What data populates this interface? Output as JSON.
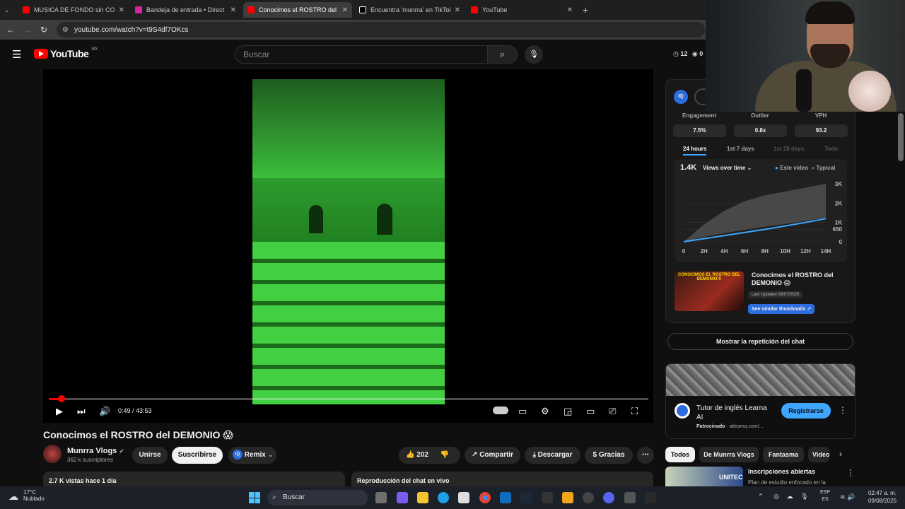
{
  "tabs": [
    {
      "label": "MUSICA DE FONDO sin COPYRI",
      "fav": "#ff0000",
      "x": 0
    },
    {
      "label": "Bandeja de entrada • Direct",
      "fav": "#d6249f"
    },
    {
      "label": "Conocimos el ROSTRO del DEM",
      "fav": "#ff0000"
    },
    {
      "label": "Encuentra 'munrra' en TikTok | B",
      "fav": "#000000"
    },
    {
      "label": "YouTube",
      "fav": "#ff0000"
    }
  ],
  "browser": {
    "url": "youtube.com/watch?v=t9S4df7OKcs",
    "new_tab": "+"
  },
  "header": {
    "logo": "YouTube",
    "country": "MX",
    "search_placeholder": "Buscar",
    "clock_count": "12",
    "eye_count": "0"
  },
  "player": {
    "time": "0:49 / 43:53",
    "progress_fraction": 0.019
  },
  "video": {
    "title": "Conocimos el ROSTRO del DEMONIO 😱",
    "channel": "Munrra Vlogs",
    "subscribers": "362 k suscriptores",
    "join": "Unirse",
    "subscribe": "Suscribirse",
    "remix": "Remix",
    "likes": "202",
    "share": "Compartir",
    "download": "Descargar",
    "thanks": "Gracias",
    "views_date": "2.7 K vistas  hace 1 día",
    "chat_live": "Reproducción del chat en vivo"
  },
  "panel": {
    "metrics": [
      {
        "label": "Engagement",
        "value": "7.5%"
      },
      {
        "label": "Outlier",
        "value": "0.8x"
      },
      {
        "label": "VPH",
        "value": "93.2"
      }
    ],
    "ranges": [
      "24 hours",
      "1st 7 days",
      "1st 28 days",
      "Todo"
    ],
    "views_total": "1.4K",
    "views_menu": "Views over time",
    "legend_this": "Este video",
    "legend_typical": "Typical",
    "thumb_title": "Conocimos el ROSTRO del DEMONIO 😱",
    "thumb_text": "CONOCIMOS EL ROSTRO DEL DEMONIO!!!",
    "last_updated": "Last Updated 08/07/2025",
    "similar": "See similar thumbnails"
  },
  "chart_data": {
    "type": "line",
    "x": [
      "0",
      "2H",
      "4H",
      "6H",
      "8H",
      "10H",
      "12H",
      "14H"
    ],
    "yticks": [
      "0",
      "650",
      "1K",
      "2K",
      "3K"
    ],
    "series": [
      {
        "name": "Este video",
        "values": [
          0,
          160,
          320,
          480,
          640,
          820,
          1000,
          1200
        ],
        "color": "#3ea6ff"
      },
      {
        "name": "Typical",
        "lower": [
          0,
          250,
          450,
          620,
          780,
          920,
          1080,
          1250
        ],
        "upper": [
          0,
          900,
          1600,
          2100,
          2400,
          2600,
          2800,
          3000
        ],
        "color": "#555555"
      }
    ]
  },
  "sidebar": {
    "chat_replay": "Mostrar la repetición del chat",
    "ad_title": "Tutor de inglés Learna AI",
    "ad_sponsored": "Patrocinado",
    "ad_domain": "· ailearna.com/...",
    "ad_cta": "Registrarse",
    "chips": [
      "Todos",
      "De Munrra Vlogs",
      "Fantasma",
      "Video"
    ],
    "rec_title": "Inscripciones abiertas",
    "rec_sub": "Plan de estudio enfocado en la",
    "rec_brand": "UNITEC"
  },
  "taskbar": {
    "temp": "17°C",
    "weather": "Nublado",
    "search": "Buscar",
    "lang": "ESP",
    "lang2": "ES",
    "time": "02:47 a. m.",
    "date": "09/08/2025"
  }
}
